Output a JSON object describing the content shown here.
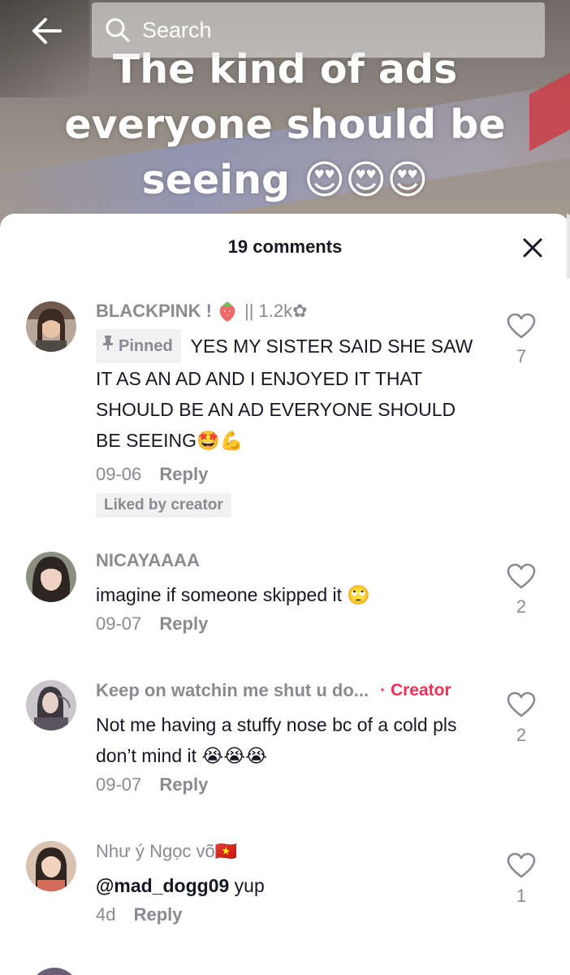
{
  "search": {
    "label": "Search"
  },
  "video": {
    "caption": "The kind of ads everyone should be seeing 😍😍😍"
  },
  "comments_panel": {
    "title": "19 comments"
  },
  "comments": [
    {
      "username": "BLACKPINK ! ",
      "username_suffix": "|| 1.2k✿",
      "pinned_label": "Pinned",
      "text": "YES MY SISTER SAID SHE SAW IT AS AN AD AND I ENJOYED IT THAT SHOULD BE AN AD EVERYONE SHOULD BE SEEING🤩💪",
      "date": "09-06",
      "reply_label": "Reply",
      "liked_by_label": "Liked by creator",
      "likes": "7"
    },
    {
      "username": "NICAYAAAA",
      "text": "imagine if someone skipped it 🙄",
      "date": "09-07",
      "reply_label": "Reply",
      "likes": "2"
    },
    {
      "username": "Keep on watchin me shut u do...",
      "badge": "· Creator",
      "text": "Not me having a stuffy nose bc of a cold pls don’t mind it 😭😭😭",
      "date": "09-07",
      "reply_label": "Reply",
      "likes": "2"
    },
    {
      "username": "Như ý Ngọc võ🇻🇳",
      "mention": "@mad_dogg09",
      "text": " yup",
      "date": "4d",
      "reply_label": "Reply",
      "likes": "1"
    }
  ]
}
